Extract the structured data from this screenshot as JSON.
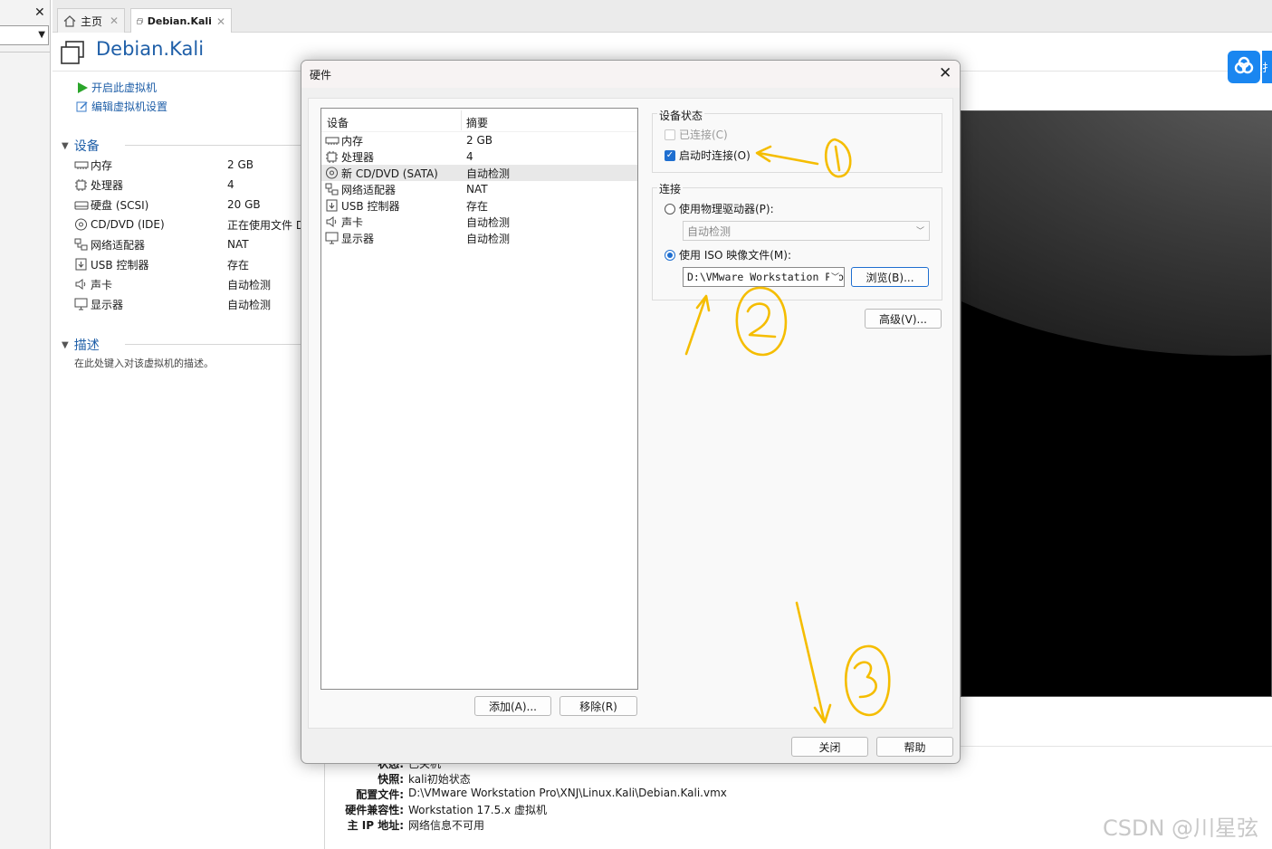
{
  "tabs": [
    {
      "label": "主页"
    },
    {
      "label": "Debian.Kali"
    }
  ],
  "vm": {
    "title": "Debian.Kali",
    "actions": {
      "start": "开启此虚拟机",
      "edit": "编辑虚拟机设置"
    },
    "devices_heading": "设备",
    "devices": [
      {
        "name": "内存",
        "value": "2 GB",
        "icon": "memory-icon"
      },
      {
        "name": "处理器",
        "value": "4",
        "icon": "processor-icon"
      },
      {
        "name": "硬盘 (SCSI)",
        "value": "20 GB",
        "icon": "hard-disk-icon"
      },
      {
        "name": "CD/DVD (IDE)",
        "value": "正在使用文件 D",
        "icon": "cd-dvd-icon"
      },
      {
        "name": "网络适配器",
        "value": "NAT",
        "icon": "network-adapter-icon"
      },
      {
        "name": "USB 控制器",
        "value": "存在",
        "icon": "usb-icon"
      },
      {
        "name": "声卡",
        "value": "自动检测",
        "icon": "speaker-icon"
      },
      {
        "name": "显示器",
        "value": "自动检测",
        "icon": "monitor-icon"
      }
    ],
    "description_heading": "描述",
    "description_placeholder": "在此处键入对该虚拟机的描述。",
    "details": [
      {
        "key": "状态:",
        "value": "已关机"
      },
      {
        "key": "快照:",
        "value": "kali初始状态"
      },
      {
        "key": "配置文件:",
        "value": "D:\\VMware Workstation Pro\\XNJ\\Linux.Kali\\Debian.Kali.vmx"
      },
      {
        "key": "硬件兼容性:",
        "value": "Workstation 17.5.x 虚拟机"
      },
      {
        "key": "主 IP 地址:",
        "value": "网络信息不可用"
      }
    ]
  },
  "dialog": {
    "title": "硬件",
    "list_header": {
      "device": "设备",
      "summary": "摘要"
    },
    "devices": [
      {
        "name": "内存",
        "summary": "2 GB",
        "icon": "memory-icon"
      },
      {
        "name": "处理器",
        "summary": "4",
        "icon": "processor-icon"
      },
      {
        "name": "新 CD/DVD (SATA)",
        "summary": "自动检测",
        "icon": "cd-dvd-icon",
        "selected": true
      },
      {
        "name": "网络适配器",
        "summary": "NAT",
        "icon": "network-adapter-icon"
      },
      {
        "name": "USB 控制器",
        "summary": "存在",
        "icon": "usb-icon"
      },
      {
        "name": "声卡",
        "summary": "自动检测",
        "icon": "speaker-icon"
      },
      {
        "name": "显示器",
        "summary": "自动检测",
        "icon": "monitor-icon"
      }
    ],
    "add_button": "添加(A)...",
    "remove_button": "移除(R)",
    "device_status": {
      "heading": "设备状态",
      "connected_label": "已连接(C)",
      "connected_checked": false,
      "connected_enabled": false,
      "connect_at_power_on_label": "启动时连接(O)",
      "connect_at_power_on_checked": true
    },
    "connection": {
      "heading": "连接",
      "physical_label": "使用物理驱动器(P):",
      "physical_selected": false,
      "physical_drive_value": "自动检测",
      "iso_label": "使用 ISO 映像文件(M):",
      "iso_selected": true,
      "iso_path": "D:\\VMware Workstation Pro",
      "browse_button": "浏览(B)..."
    },
    "advanced_button": "高级(V)...",
    "close_button": "关闭",
    "help_button": "帮助"
  },
  "watermark": "CSDN @川星弦",
  "colors": {
    "accent": "#1f6fd0",
    "title_blue": "#1f5fa8",
    "annotation": "#f5bd00",
    "cloud_button": "#1a86f0"
  }
}
